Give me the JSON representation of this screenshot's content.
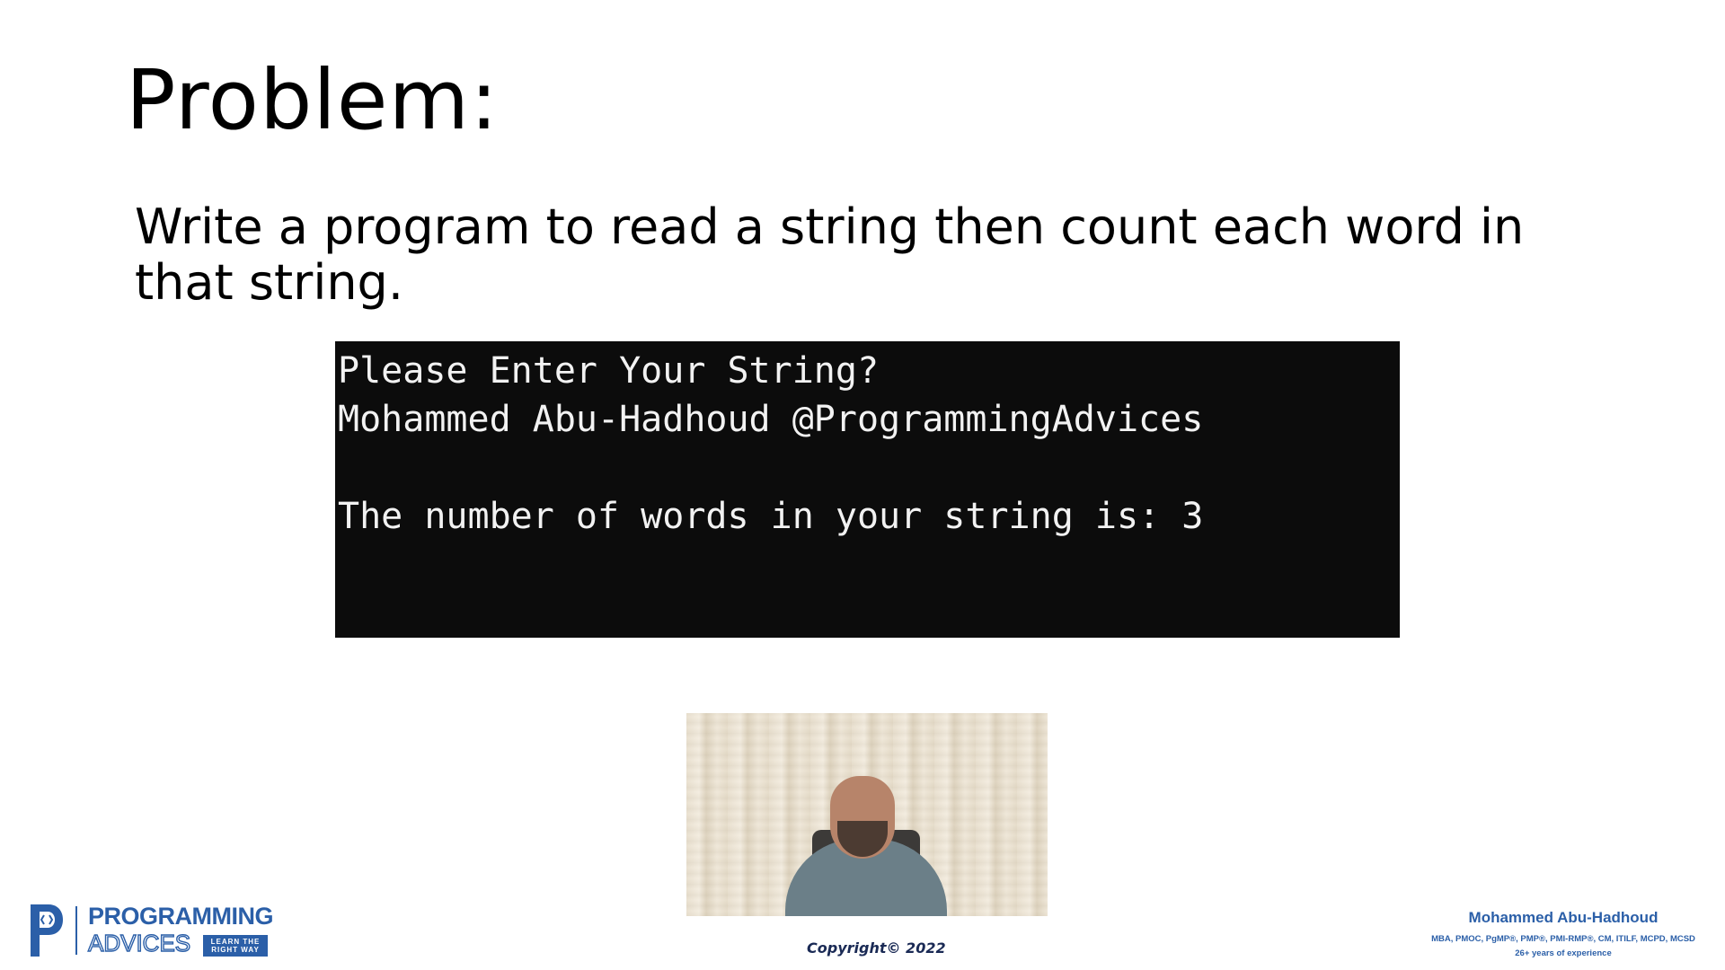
{
  "slide": {
    "title": "Problem:",
    "problem_text": "Write a program to read a string then count each word in that string."
  },
  "console": {
    "lines": [
      "Please Enter Your String?",
      "Mohammed Abu-Hadhoud @ProgrammingAdvices",
      "",
      "The number of words in your string is: 3"
    ]
  },
  "logo": {
    "word1": "PROGRAMMING",
    "word2": "ADVICES",
    "tagline_line1": "LEARN THE",
    "tagline_line2": "RIGHT WAY"
  },
  "footer": {
    "copyright": "Copyright© 2022"
  },
  "author": {
    "name": "Mohammed Abu-Hadhoud",
    "credentials": "MBA, PMOC, PgMP®, PMP®, PMI-RMP®, CM, ITILF, MCPD, MCSD",
    "experience": "26+ years of experience"
  },
  "colors": {
    "brand_blue": "#2b5fa8",
    "console_bg": "#0c0c0c",
    "console_text": "#f2f2f2"
  },
  "icons": {
    "logo_mark": "p-code-logo-icon"
  }
}
